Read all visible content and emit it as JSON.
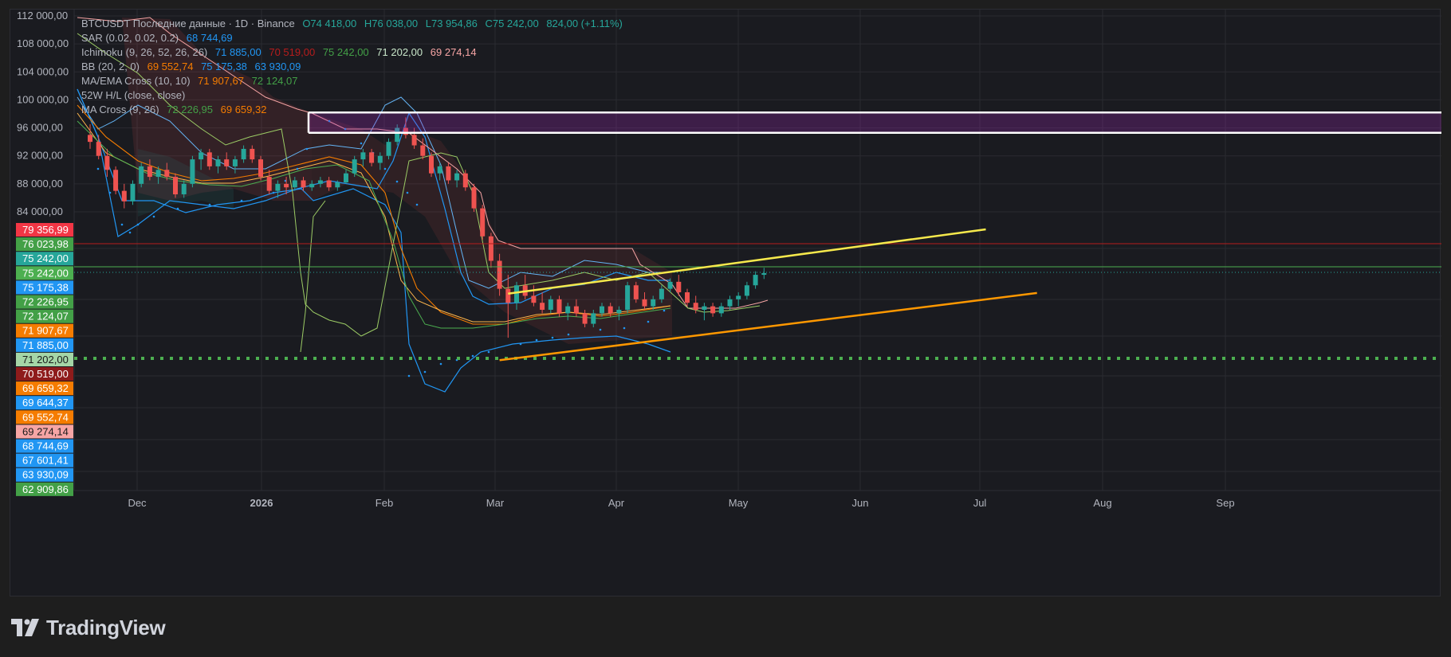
{
  "legend": {
    "title": {
      "text": "BTCUSDT Последние данные · 1D · Binance",
      "o": "O74 418,00",
      "h": "H76 038,00",
      "l": "L73 954,86",
      "c": "C75 242,00",
      "chg": "824,00 (+1.11%)"
    },
    "sar": {
      "label": "SAR (0.02, 0.02, 0.2)",
      "v1": "68 744,69"
    },
    "ichimoku": {
      "label": "Ichimoku (9, 26, 52, 26, 26)",
      "v1": "71 885,00",
      "v2": "70 519,00",
      "v3": "75 242,00",
      "v4": "71 202,00",
      "v5": "69 274,14"
    },
    "bb": {
      "label": "BB (20, 2, 0)",
      "v1": "69 552,74",
      "v2": "75 175,38",
      "v3": "63 930,09"
    },
    "ema": {
      "label": "MA/EMA Cross (10, 10)",
      "v1": "71 907,67",
      "v2": "72 124,07"
    },
    "hl52": {
      "label": "52W H/L (close, close)"
    },
    "macross": {
      "label": "MA Cross (9, 26)",
      "v1": "72 226,95",
      "v2": "69 659,32"
    }
  },
  "colors": {
    "up": "#26a69a",
    "down": "#ef5350",
    "bb": "#2196f3",
    "ema_orange": "#f57c00",
    "ema_green": "#4caf50",
    "ichi_pink": "#f7a5a5",
    "ichi_green": "#9ccc65",
    "trend_yellow": "#f6e94c",
    "trend_orange": "#ff9800",
    "box": "#ffffff"
  },
  "chart_data": {
    "type": "candlestick",
    "symbol": "BTCUSDT",
    "timeframe": "1D",
    "exchange": "Binance",
    "ylim": [
      62000,
      113000
    ],
    "y_ticks": [
      {
        "label": "112 000,00",
        "value": 112000
      },
      {
        "label": "108 000,00",
        "value": 108000
      },
      {
        "label": "104 000,00",
        "value": 104000
      },
      {
        "label": "100 000,00",
        "value": 100000
      },
      {
        "label": "96 000,00",
        "value": 96000
      },
      {
        "label": "92 000,00",
        "value": 92000
      },
      {
        "label": "88 000,00",
        "value": 88000
      },
      {
        "label": "84 000,00",
        "value": 84000
      }
    ],
    "x_ticks": [
      {
        "label": "Dec",
        "bold": false
      },
      {
        "label": "2026",
        "bold": true
      },
      {
        "label": "Feb",
        "bold": false
      },
      {
        "label": "Mar",
        "bold": false
      },
      {
        "label": "Apr",
        "bold": false
      },
      {
        "label": "May",
        "bold": false
      },
      {
        "label": "Jun",
        "bold": false
      },
      {
        "label": "Jul",
        "bold": false
      },
      {
        "label": "Aug",
        "bold": false
      },
      {
        "label": "Sep",
        "bold": false
      }
    ],
    "price_tags": [
      {
        "text": "79 356,99",
        "value": 79356.99,
        "bg": "#f23645",
        "fg": "#ffffff"
      },
      {
        "text": "76 023,98",
        "value": 76023.98,
        "bg": "#43a047",
        "fg": "#ffffff"
      },
      {
        "text": "75 242,00",
        "value": 75242,
        "bg": "#26a69a",
        "fg": "#ffffff"
      },
      {
        "text": "75 242,00",
        "value": 75242,
        "bg": "#4caf50",
        "fg": "#ffffff"
      },
      {
        "text": "75 175,38",
        "value": 75175.38,
        "bg": "#2196f3",
        "fg": "#ffffff"
      },
      {
        "text": "72 226,95",
        "value": 72226.95,
        "bg": "#43a047",
        "fg": "#ffffff"
      },
      {
        "text": "72 124,07",
        "value": 72124.07,
        "bg": "#43a047",
        "fg": "#ffffff"
      },
      {
        "text": "71 907,67",
        "value": 71907.67,
        "bg": "#f57c00",
        "fg": "#ffffff"
      },
      {
        "text": "71 885,00",
        "value": 71885,
        "bg": "#2196f3",
        "fg": "#ffffff"
      },
      {
        "text": "71 202,00",
        "value": 71202,
        "bg": "#a5d6a7",
        "fg": "#1a1a1a"
      },
      {
        "text": "70 519,00",
        "value": 70519,
        "bg": "#8e1b1b",
        "fg": "#ffffff"
      },
      {
        "text": "69 659,32",
        "value": 69659.32,
        "bg": "#f57c00",
        "fg": "#ffffff"
      },
      {
        "text": "69 644,37",
        "value": 69644.37,
        "bg": "#2196f3",
        "fg": "#ffffff"
      },
      {
        "text": "69 552,74",
        "value": 69552.74,
        "bg": "#f57c00",
        "fg": "#ffffff"
      },
      {
        "text": "69 274,14",
        "value": 69274.14,
        "bg": "#f7a5a5",
        "fg": "#1a1a1a"
      },
      {
        "text": "68 744,69",
        "value": 68744.69,
        "bg": "#2196f3",
        "fg": "#ffffff"
      },
      {
        "text": "67 601,41",
        "value": 67601.41,
        "bg": "#2196f3",
        "fg": "#ffffff"
      },
      {
        "text": "63 930,09",
        "value": 63930.09,
        "bg": "#2196f3",
        "fg": "#ffffff"
      },
      {
        "text": "62 909,86",
        "value": 62909.86,
        "bg": "#43a047",
        "fg": "#ffffff"
      }
    ],
    "candles": [
      [
        95,
        96.5,
        93,
        94
      ],
      [
        94,
        95,
        91.5,
        92
      ],
      [
        92,
        93,
        89,
        90
      ],
      [
        90,
        90.5,
        86.5,
        87
      ],
      [
        87,
        88,
        84.5,
        85.5
      ],
      [
        85.5,
        88.5,
        85,
        88
      ],
      [
        88,
        91,
        87.5,
        90.5
      ],
      [
        90.5,
        91.5,
        88.5,
        89
      ],
      [
        89,
        90.5,
        88,
        90
      ],
      [
        90,
        91,
        88.5,
        89
      ],
      [
        89,
        89.5,
        86,
        86.5
      ],
      [
        86.5,
        88.5,
        86,
        88
      ],
      [
        88,
        92,
        87.5,
        91.5
      ],
      [
        91.5,
        93,
        90,
        92.5
      ],
      [
        92.5,
        93,
        90,
        90.5
      ],
      [
        90.5,
        92,
        89.5,
        91.5
      ],
      [
        91.5,
        92.5,
        90,
        90.5
      ],
      [
        90.5,
        92,
        89.5,
        91.5
      ],
      [
        91.5,
        93.5,
        91,
        93
      ],
      [
        93,
        93.5,
        91,
        91.5
      ],
      [
        91.5,
        92,
        88.5,
        89
      ],
      [
        89,
        90,
        86.5,
        87
      ],
      [
        87,
        88.5,
        86,
        88
      ],
      [
        88,
        89,
        86.5,
        87.5
      ],
      [
        87.5,
        89,
        87,
        88.5
      ],
      [
        88.5,
        89,
        87,
        87.5
      ],
      [
        87.5,
        88.5,
        87,
        88
      ],
      [
        88,
        89,
        87.5,
        88.5
      ],
      [
        88.5,
        89,
        87,
        87.5
      ],
      [
        87.5,
        88.5,
        87,
        88.2
      ],
      [
        88.2,
        90,
        88,
        89.5
      ],
      [
        89.5,
        92,
        89,
        91.5
      ],
      [
        91.5,
        93,
        90.5,
        92.5
      ],
      [
        92.5,
        93,
        90.5,
        91
      ],
      [
        91,
        92.5,
        90,
        92
      ],
      [
        92,
        94.5,
        91.5,
        94
      ],
      [
        94,
        96.5,
        93.5,
        96
      ],
      [
        96,
        97.5,
        94.5,
        95
      ],
      [
        95,
        96,
        93,
        93.5
      ],
      [
        93.5,
        94.5,
        91.5,
        92
      ],
      [
        92,
        92.5,
        89,
        89.5
      ],
      [
        89.5,
        91,
        88.5,
        90.5
      ],
      [
        90.5,
        91,
        88,
        88.5
      ],
      [
        88.5,
        90,
        87.5,
        89.5
      ],
      [
        89.5,
        90,
        87,
        87.5
      ],
      [
        87.5,
        88,
        84,
        84.5
      ],
      [
        84.5,
        85,
        80,
        80.5
      ],
      [
        80.5,
        81,
        76,
        77
      ],
      [
        77,
        78,
        72,
        73
      ],
      [
        73,
        75,
        66,
        71
      ],
      [
        71,
        74,
        70,
        73.5
      ],
      [
        73.5,
        75,
        71.5,
        72
      ],
      [
        72,
        73.5,
        70.5,
        71
      ],
      [
        71,
        72.5,
        69.5,
        70
      ],
      [
        70,
        72,
        69.5,
        71.5
      ],
      [
        71.5,
        72,
        69,
        69.5
      ],
      [
        69.5,
        71,
        68.5,
        70.5
      ],
      [
        70.5,
        71.5,
        69,
        69.5
      ],
      [
        69.5,
        70,
        67.5,
        68
      ],
      [
        68,
        70,
        67.5,
        69.5
      ],
      [
        69.5,
        71,
        69,
        70.5
      ],
      [
        70.5,
        71,
        69,
        69.5
      ],
      [
        69.5,
        70.5,
        68.5,
        70
      ],
      [
        70,
        74,
        69.5,
        73.5
      ],
      [
        73.5,
        74,
        71,
        71.5
      ],
      [
        71.5,
        72.5,
        70,
        70.5
      ],
      [
        70.5,
        72,
        70,
        71.5
      ],
      [
        71.5,
        73.5,
        71,
        73
      ],
      [
        73,
        74.5,
        72.5,
        74
      ],
      [
        74,
        75,
        72,
        72.5
      ],
      [
        72.5,
        73,
        70.5,
        71
      ],
      [
        71,
        72,
        69.5,
        70
      ],
      [
        70,
        71,
        68.5,
        70.5
      ],
      [
        70.5,
        71,
        69,
        69.5
      ],
      [
        69.5,
        71,
        69,
        70.5
      ],
      [
        70.5,
        72,
        70,
        71.5
      ],
      [
        71.5,
        72.5,
        70.5,
        72
      ],
      [
        72,
        74,
        71.5,
        73.5
      ],
      [
        73.5,
        75.5,
        73,
        75
      ],
      [
        75,
        76,
        74.4,
        75.24
      ]
    ],
    "extra_lines": {
      "resistance_box": [
        95300,
        98200
      ],
      "trend_upper": [
        [
          49,
          72300
        ],
        [
          105,
          81500
        ]
      ],
      "trend_lower": [
        [
          48,
          62800
        ],
        [
          111,
          72400
        ]
      ],
      "dotted_support": 71202
    }
  }
}
